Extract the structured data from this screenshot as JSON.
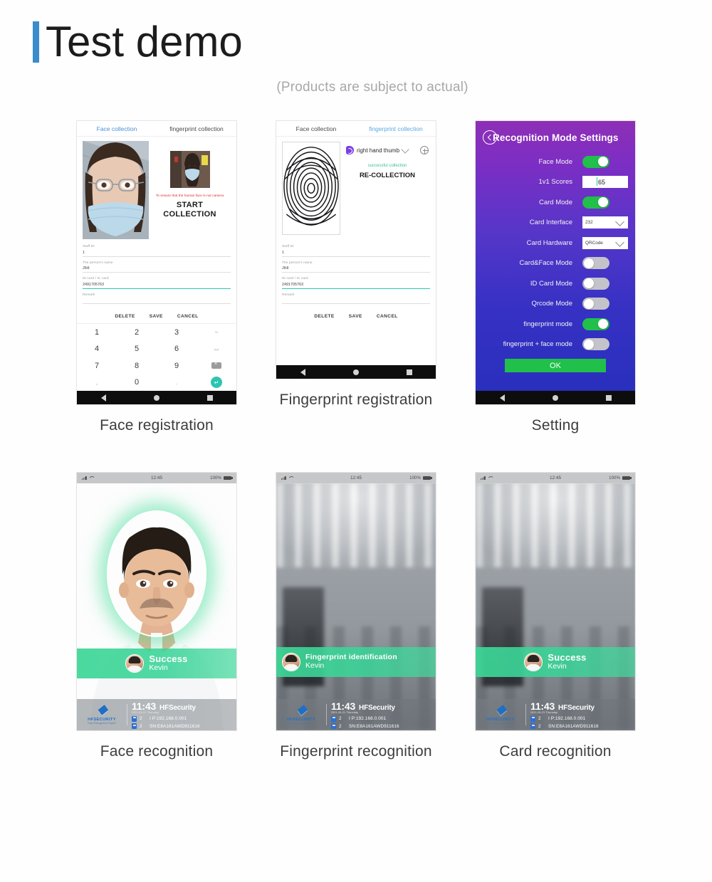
{
  "header": {
    "title": "Test demo",
    "subtitle": "(Products are subject to actual)",
    "accent_color": "#3a8ccc"
  },
  "cards": [
    {
      "caption": "Face registration"
    },
    {
      "caption": "Fingerprint registration"
    },
    {
      "caption": "Setting"
    },
    {
      "caption": "Face recognition"
    },
    {
      "caption": "Fingerprint recognition"
    },
    {
      "caption": "Card recognition"
    }
  ],
  "registration": {
    "tabs": {
      "face": "Face collection",
      "fingerprint": "fingerprint collection"
    },
    "face_screen": {
      "warning": "To ensure that the human face is not camera",
      "start_button": "START COLLECTION"
    },
    "fingerprint_screen": {
      "finger_label": "right hand thumb",
      "status": "successful collection",
      "recollect_button": "RE-COLLECTION"
    },
    "form": {
      "fields": [
        {
          "label": "Staff ID",
          "value": "1"
        },
        {
          "label": "The person's name",
          "value": "JIHI"
        },
        {
          "label": "ID card / IC card",
          "value": "2491705763"
        },
        {
          "label": "Remark",
          "value": ""
        }
      ],
      "buttons": {
        "delete": "DELETE",
        "save": "SAVE",
        "cancel": "CANCEL"
      }
    },
    "keypad": {
      "keys": [
        "1",
        "2",
        "3",
        "–",
        "4",
        "5",
        "6",
        "⌴",
        "7",
        "8",
        "9",
        "del",
        "‚",
        "0",
        ".",
        "enter"
      ]
    }
  },
  "settings": {
    "title": "Recognition Mode Settings",
    "back_icon": "back-arrow-icon",
    "rows": [
      {
        "label": "Face Mode",
        "type": "toggle",
        "state": "on"
      },
      {
        "label": "1v1 Scores",
        "type": "text",
        "value": "65"
      },
      {
        "label": "Card Mode",
        "type": "toggle",
        "state": "on"
      },
      {
        "label": "Card Interface",
        "type": "select",
        "value": "232"
      },
      {
        "label": "Card Hardware",
        "type": "select",
        "value": "QRCode"
      },
      {
        "label": "Card&Face Mode",
        "type": "toggle",
        "state": "off"
      },
      {
        "label": "ID Card Mode",
        "type": "toggle",
        "state": "off"
      },
      {
        "label": "Qrcode Mode",
        "type": "toggle",
        "state": "off"
      },
      {
        "label": "fingerprint mode",
        "type": "toggle",
        "state": "on"
      },
      {
        "label": "fingerprint + face mode",
        "type": "toggle",
        "state": "off"
      }
    ],
    "ok_button": "OK",
    "toggle_on_color": "#21c04b",
    "toggle_off_color": "#c3c3c9"
  },
  "recognition": {
    "statusbar": {
      "time": "12:45",
      "battery": "100%"
    },
    "footer": {
      "time": "11:43",
      "brand": "HFSecurity",
      "date": "2021-05-21 Thursday",
      "rows": [
        {
          "num": "2",
          "text": "I P:192.168.0.001"
        },
        {
          "num": "2",
          "text": "SN:E8A161AWD911616"
        }
      ],
      "logo_name": "HFSECURITY",
      "logo_sub": "Face Recognition Expert"
    },
    "face": {
      "banner_main": "Success",
      "banner_sub": "Kevin",
      "align": "center"
    },
    "fingerprint": {
      "banner_main": "Fingerprint identification",
      "banner_sub": "Kevin",
      "align": "left"
    },
    "card": {
      "banner_main": "Success",
      "banner_sub": "Kevin",
      "align": "center"
    }
  }
}
